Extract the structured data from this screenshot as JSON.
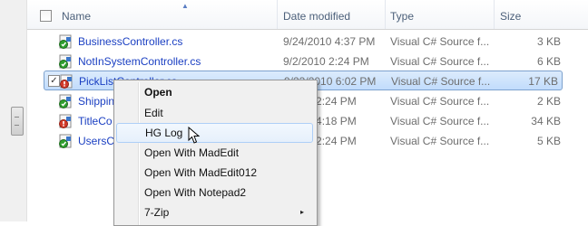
{
  "header": {
    "name_label": "Name",
    "date_label": "Date modified",
    "type_label": "Type",
    "size_label": "Size"
  },
  "files": [
    {
      "name": "BusinessController.cs",
      "date": "9/24/2010 4:37 PM",
      "type": "Visual C# Source f...",
      "size": "3 KB",
      "icon": "cs-file-green-check-icon"
    },
    {
      "name": "NotInSystemController.cs",
      "date": "9/2/2010 2:24 PM",
      "type": "Visual C# Source f...",
      "size": "6 KB",
      "icon": "cs-file-green-check-icon"
    },
    {
      "name": "PickListController.cs",
      "date": "9/23/2010 6:02 PM",
      "type": "Visual C# Source f...",
      "size": "17 KB",
      "icon": "cs-file-red-modified-icon",
      "selected": true
    },
    {
      "name": "Shippin",
      "date": "2010 2:24 PM",
      "type": "Visual C# Source f...",
      "size": "2 KB",
      "icon": "cs-file-green-check-icon"
    },
    {
      "name": "TitleCo",
      "date": "2010 4:18 PM",
      "type": "Visual C# Source f...",
      "size": "34 KB",
      "icon": "cs-file-red-modified-icon"
    },
    {
      "name": "UsersCo",
      "date": "2010 2:24 PM",
      "type": "Visual C# Source f...",
      "size": "5 KB",
      "icon": "cs-file-green-check-icon"
    }
  ],
  "context_menu": {
    "items": [
      {
        "label": "Open",
        "bold": true
      },
      {
        "label": "Edit"
      },
      {
        "label": "HG Log",
        "hovered": true
      },
      {
        "label": "Open With MadEdit"
      },
      {
        "label": "Open With MadEdit012"
      },
      {
        "label": "Open With Notepad2"
      },
      {
        "label": "7-Zip",
        "submenu": true
      }
    ],
    "submenu_arrow": "▸"
  },
  "colors": {
    "file_link": "#1a3fc2",
    "selection_fill": "#c1dcfc",
    "selection_border": "#7da2ce",
    "header_text": "#4c607a"
  }
}
